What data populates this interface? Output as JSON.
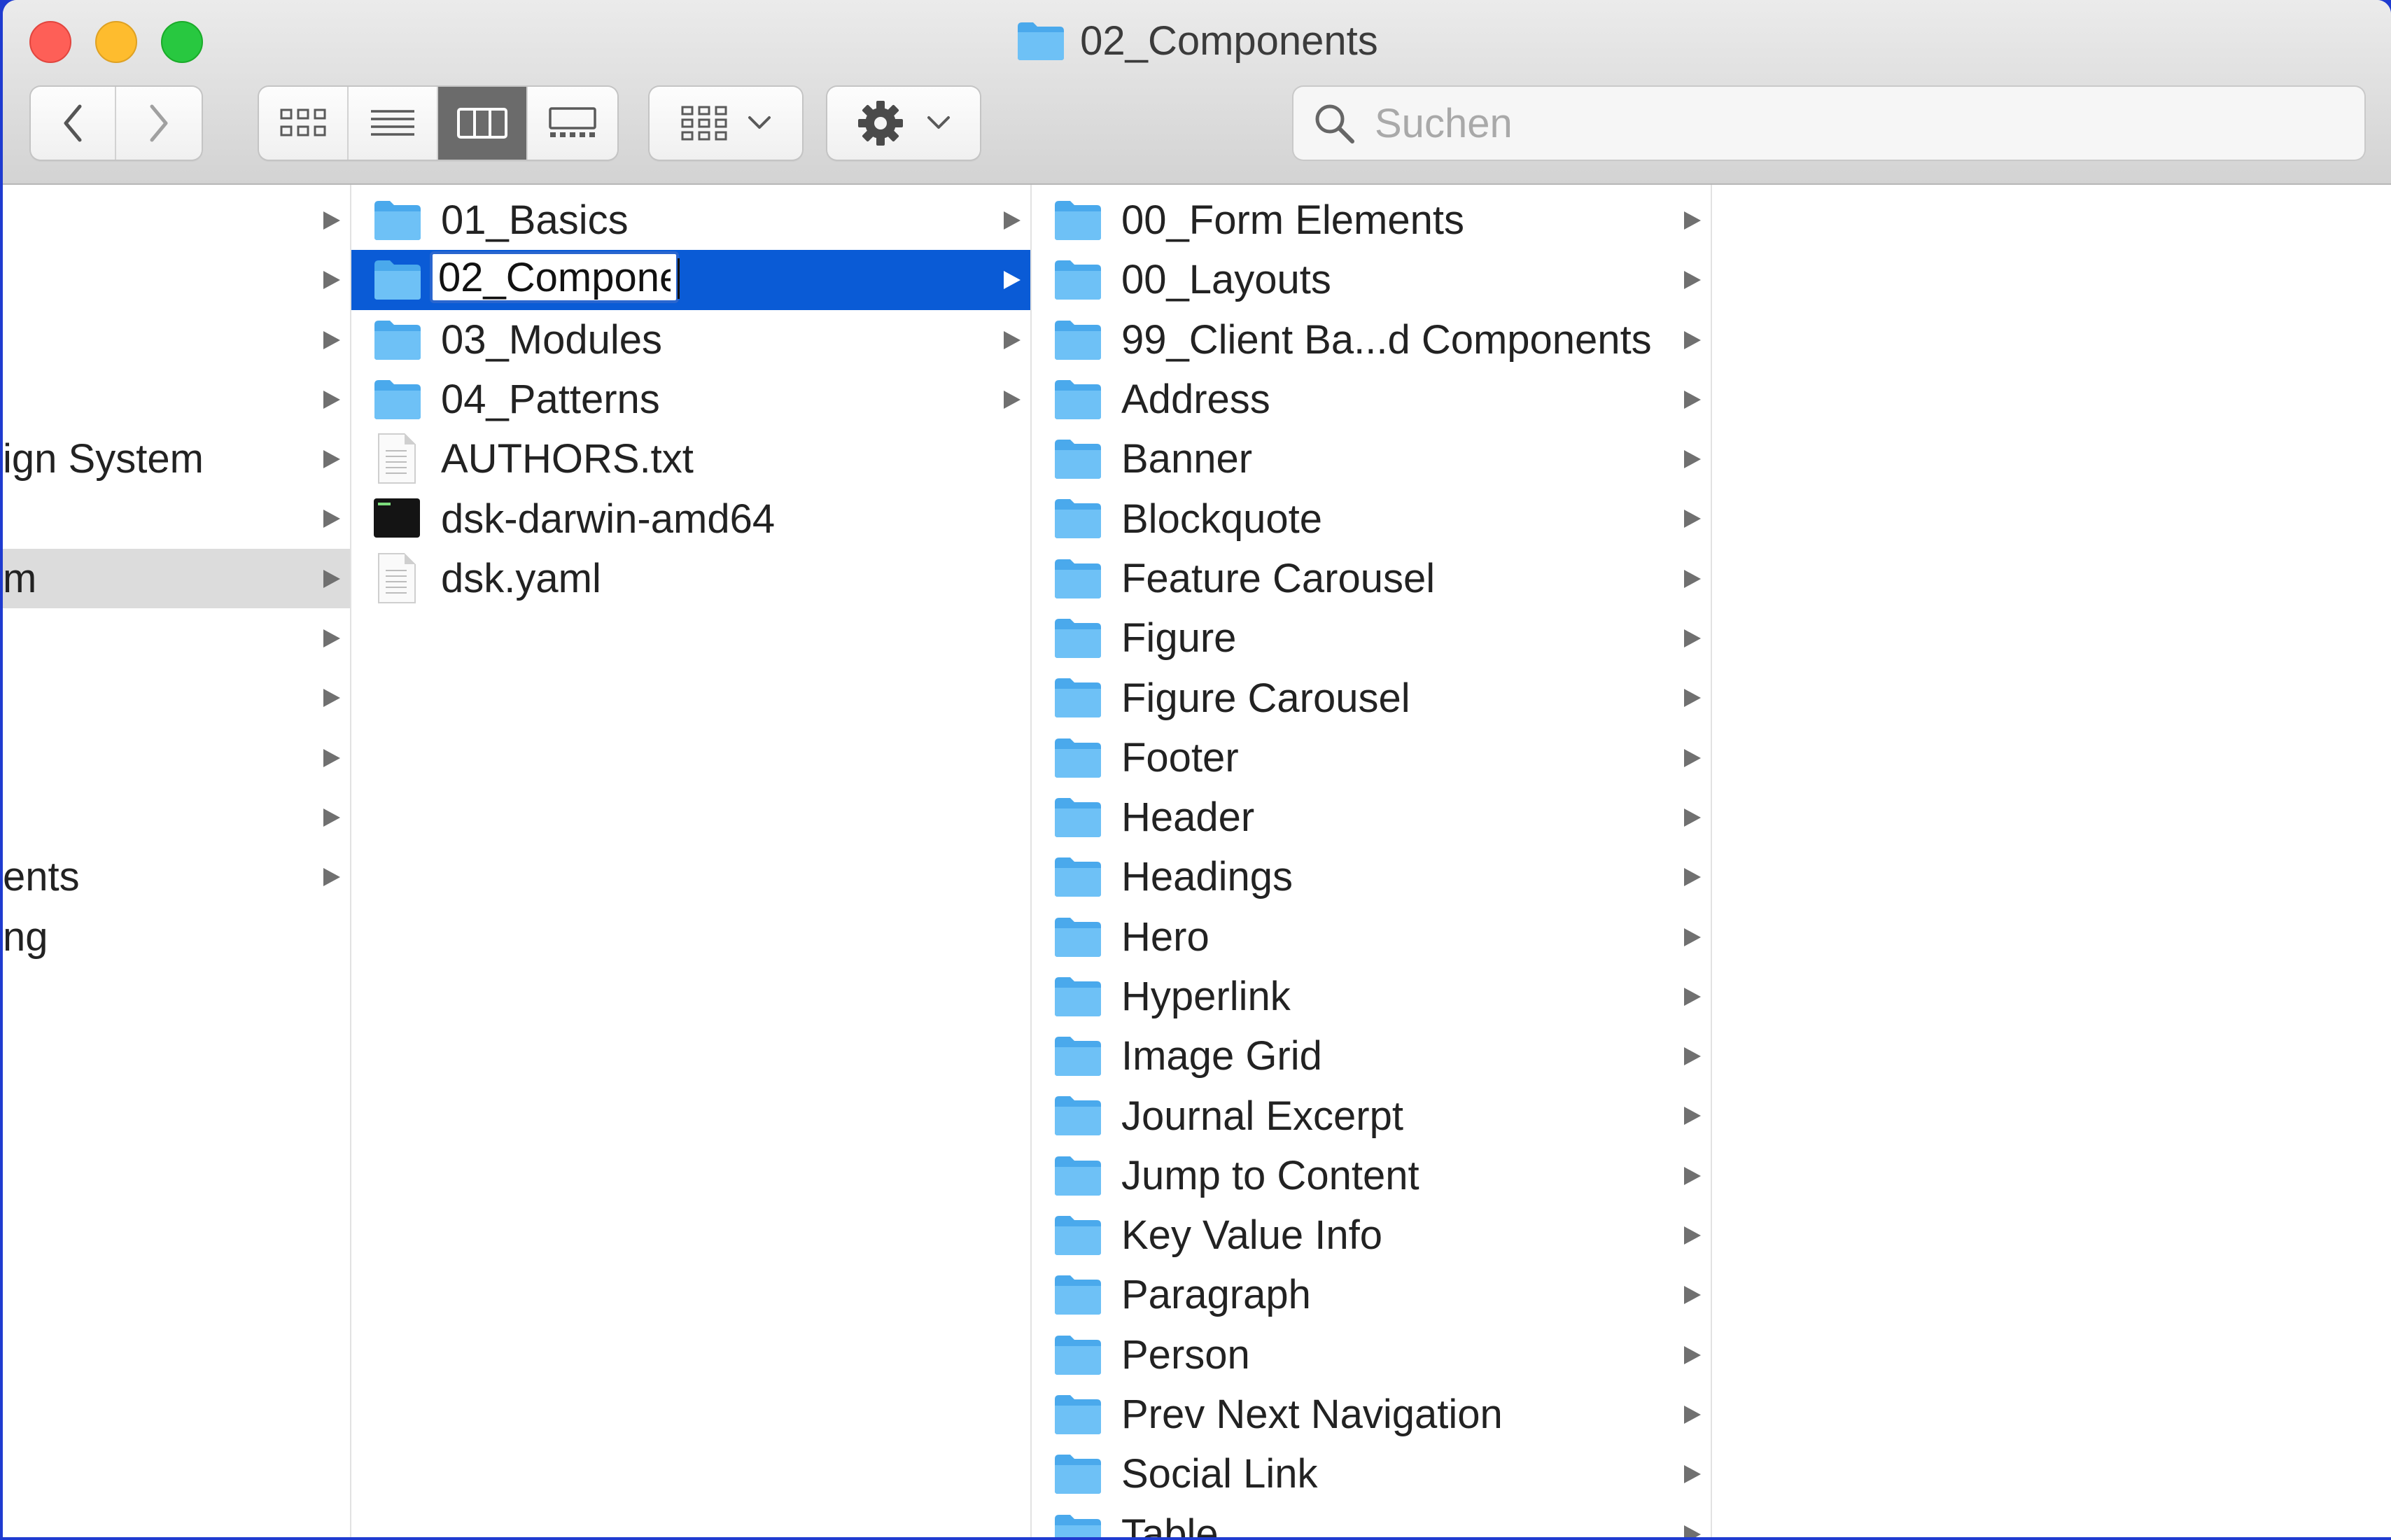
{
  "window": {
    "title": "02_Components"
  },
  "toolbar": {
    "back_icon": "chevron-left-icon",
    "forward_icon": "chevron-right-icon",
    "view_icons": [
      "icon-view-icon",
      "list-view-icon",
      "column-view-icon",
      "gallery-view-icon"
    ],
    "active_view": "column-view",
    "group_icon": "group-by-icon",
    "action_icon": "gear-icon"
  },
  "search": {
    "placeholder": "Suchen",
    "value": ""
  },
  "column1": {
    "items": [
      {
        "label": ""
      },
      {
        "label": ""
      },
      {
        "label": ""
      },
      {
        "label": ""
      },
      {
        "label": "ign System"
      },
      {
        "label": ""
      },
      {
        "label": "m",
        "highlighted": true
      },
      {
        "label": ""
      },
      {
        "label": ""
      },
      {
        "label": ""
      },
      {
        "label": ""
      },
      {
        "label": "ents"
      },
      {
        "label": "ng"
      }
    ]
  },
  "column2": {
    "rename_value": "02_Compone",
    "items": [
      {
        "label": "01_Basics",
        "kind": "folder"
      },
      {
        "label": "",
        "kind": "folder",
        "selected": true
      },
      {
        "label": "03_Modules",
        "kind": "folder"
      },
      {
        "label": "04_Patterns",
        "kind": "folder"
      },
      {
        "label": "AUTHORS.txt",
        "kind": "text-file"
      },
      {
        "label": "dsk-darwin-amd64",
        "kind": "executable"
      },
      {
        "label": "dsk.yaml",
        "kind": "text-file"
      }
    ]
  },
  "column3": {
    "items": [
      "00_Form Elements",
      "00_Layouts",
      "99_Client Ba...d Components",
      "Address",
      "Banner",
      "Blockquote",
      "Feature Carousel",
      "Figure",
      "Figure Carousel",
      "Footer",
      "Header",
      "Headings",
      "Hero",
      "Hyperlink",
      "Image Grid",
      "Journal Excerpt",
      "Jump to Content",
      "Key Value Info",
      "Paragraph",
      "Person",
      "Prev Next Navigation",
      "Social Link",
      "Table"
    ]
  },
  "colors": {
    "selection": "#0a5bd6",
    "folder": "#5ab4f2",
    "highlight": "#dcdcdc"
  }
}
